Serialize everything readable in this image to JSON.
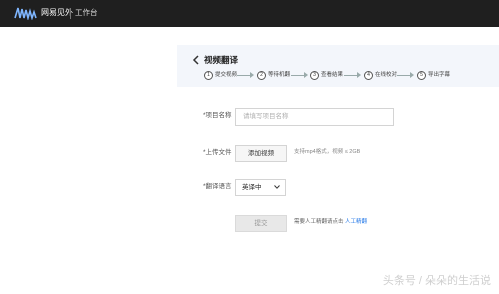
{
  "header": {
    "brand": "网易见外",
    "workspace": "工作台"
  },
  "page": {
    "title": "视频翻译",
    "steps": [
      {
        "num": "1",
        "label": "提交视频"
      },
      {
        "num": "2",
        "label": "等待机翻"
      },
      {
        "num": "3",
        "label": "查看结果"
      },
      {
        "num": "4",
        "label": "在线校对"
      },
      {
        "num": "5",
        "label": "导出字幕"
      }
    ]
  },
  "form": {
    "project_name_label": "*项目名称",
    "project_name_placeholder": "请填写项目名称",
    "upload_label": "*上传文件",
    "upload_button": "添加视频",
    "upload_hint": "支持mp4格式，视频 ≤ 2GB",
    "language_label": "*翻译语言",
    "language_value": "英译中",
    "submit_button": "提交",
    "submit_hint_prefix": "需要人工精翻请点击",
    "submit_hint_link": "人工精翻"
  },
  "watermark": "头条号 / 朵朵的生活说"
}
